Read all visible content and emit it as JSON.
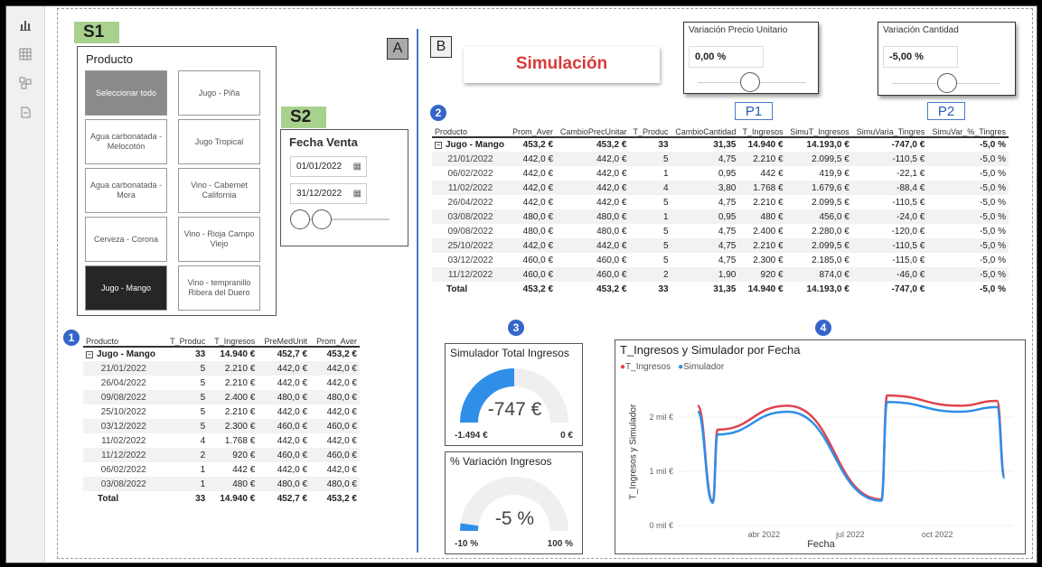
{
  "rail_icons": [
    "bar-chart-icon",
    "table-icon",
    "model-icon",
    "dax-query-icon"
  ],
  "tags": {
    "s1": "S1",
    "s2": "S2",
    "a": "A",
    "b": "B",
    "p1": "P1",
    "p2": "P2"
  },
  "markers": {
    "one": "1",
    "two": "2",
    "three": "3",
    "four": "4"
  },
  "producto_slicer": {
    "title": "Producto",
    "items": [
      "Seleccionar todo",
      "Jugo - Piña",
      "Agua carbonatada - Melocotón",
      "Jugo Tropical",
      "Agua carbonatada - Mora",
      "Vino - Cabernet California",
      "Cerveza - Corona",
      "Vino - Rioja Campo Viejo",
      "Jugo - Mango",
      "Vino - tempranillo Ribera del Duero"
    ]
  },
  "fecha_slicer": {
    "title": "Fecha Venta",
    "from": "01/01/2022",
    "to": "31/12/2022"
  },
  "simulacion_button": "Simulación",
  "param_precio": {
    "title": "Variación Precio Unitario",
    "value": "0,00 %"
  },
  "param_cantidad": {
    "title": "Variación Cantidad",
    "value": "-5,00 %"
  },
  "table1": {
    "headers": [
      "Producto",
      "T_Produc",
      "T_Ingresos",
      "PreMedUnit",
      "Prom_Aver"
    ],
    "group": [
      "Jugo - Mango",
      "33",
      "14.940 €",
      "452,7 €",
      "453,2 €"
    ],
    "rows": [
      [
        "21/01/2022",
        "5",
        "2.210 €",
        "442,0 €",
        "442,0 €"
      ],
      [
        "26/04/2022",
        "5",
        "2.210 €",
        "442,0 €",
        "442,0 €"
      ],
      [
        "09/08/2022",
        "5",
        "2.400 €",
        "480,0 €",
        "480,0 €"
      ],
      [
        "25/10/2022",
        "5",
        "2.210 €",
        "442,0 €",
        "442,0 €"
      ],
      [
        "03/12/2022",
        "5",
        "2.300 €",
        "460,0 €",
        "460,0 €"
      ],
      [
        "11/02/2022",
        "4",
        "1.768 €",
        "442,0 €",
        "442,0 €"
      ],
      [
        "11/12/2022",
        "2",
        "920 €",
        "460,0 €",
        "460,0 €"
      ],
      [
        "06/02/2022",
        "1",
        "442 €",
        "442,0 €",
        "442,0 €"
      ],
      [
        "03/08/2022",
        "1",
        "480 €",
        "480,0 €",
        "480,0 €"
      ]
    ],
    "total": [
      "Total",
      "33",
      "14.940 €",
      "452,7 €",
      "453,2 €"
    ]
  },
  "table2": {
    "headers": [
      "Producto",
      "Prom_Aver",
      "CambioPrecUnitar",
      "T_Produc",
      "CambioCantidad",
      "T_Ingresos",
      "SimuT_Ingresos",
      "SimuVaria_Tingres",
      "SimuVar_%_Tingres"
    ],
    "group": [
      "Jugo - Mango",
      "453,2 €",
      "453,2 €",
      "33",
      "31,35",
      "14.940 €",
      "14.193,0 €",
      "-747,0 €",
      "-5,0 %"
    ],
    "rows": [
      [
        "21/01/2022",
        "442,0 €",
        "442,0 €",
        "5",
        "4,75",
        "2.210 €",
        "2.099,5 €",
        "-110,5 €",
        "-5,0 %"
      ],
      [
        "06/02/2022",
        "442,0 €",
        "442,0 €",
        "1",
        "0,95",
        "442 €",
        "419,9 €",
        "-22,1 €",
        "-5,0 %"
      ],
      [
        "11/02/2022",
        "442,0 €",
        "442,0 €",
        "4",
        "3,80",
        "1.768 €",
        "1.679,6 €",
        "-88,4 €",
        "-5,0 %"
      ],
      [
        "26/04/2022",
        "442,0 €",
        "442,0 €",
        "5",
        "4,75",
        "2.210 €",
        "2.099,5 €",
        "-110,5 €",
        "-5,0 %"
      ],
      [
        "03/08/2022",
        "480,0 €",
        "480,0 €",
        "1",
        "0,95",
        "480 €",
        "456,0 €",
        "-24,0 €",
        "-5,0 %"
      ],
      [
        "09/08/2022",
        "480,0 €",
        "480,0 €",
        "5",
        "4,75",
        "2.400 €",
        "2.280,0 €",
        "-120,0 €",
        "-5,0 %"
      ],
      [
        "25/10/2022",
        "442,0 €",
        "442,0 €",
        "5",
        "4,75",
        "2.210 €",
        "2.099,5 €",
        "-110,5 €",
        "-5,0 %"
      ],
      [
        "03/12/2022",
        "460,0 €",
        "460,0 €",
        "5",
        "4,75",
        "2.300 €",
        "2.185,0 €",
        "-115,0 €",
        "-5,0 %"
      ],
      [
        "11/12/2022",
        "460,0 €",
        "460,0 €",
        "2",
        "1,90",
        "920 €",
        "874,0 €",
        "-46,0 €",
        "-5,0 %"
      ]
    ],
    "total": [
      "Total",
      "453,2 €",
      "453,2 €",
      "33",
      "31,35",
      "14.940 €",
      "14.193,0 €",
      "-747,0 €",
      "-5,0 %"
    ]
  },
  "gauge_total": {
    "title": "Simulador Total Ingresos",
    "value": "-747 €",
    "min": "-1.494 €",
    "max": "0 €",
    "fill_fraction": 0.5
  },
  "gauge_pct": {
    "title": "% Variación Ingresos",
    "value": "-5 %",
    "min": "-10 %",
    "max": "100 %",
    "fill_fraction": 0.045
  },
  "chart_data": {
    "type": "line",
    "title": "T_Ingresos y Simulador por Fecha",
    "xlabel": "Fecha",
    "ylabel": "T_Ingresos y Simulador",
    "y_ticks": [
      "0 mil €",
      "1 mil €",
      "2 mil €"
    ],
    "x_ticks": [
      "abr 2022",
      "jul 2022",
      "oct 2022"
    ],
    "ylim": [
      0,
      2500
    ],
    "series": [
      {
        "name": "T_Ingresos",
        "color": "#e0434f",
        "points": [
          [
            "2022-01-21",
            2210
          ],
          [
            "2022-02-06",
            442
          ],
          [
            "2022-02-11",
            1768
          ],
          [
            "2022-04-26",
            2210
          ],
          [
            "2022-08-03",
            480
          ],
          [
            "2022-08-09",
            2400
          ],
          [
            "2022-10-25",
            2210
          ],
          [
            "2022-12-03",
            2300
          ],
          [
            "2022-12-11",
            920
          ]
        ]
      },
      {
        "name": "Simulador",
        "color": "#2f8fe8",
        "points": [
          [
            "2022-01-21",
            2099.5
          ],
          [
            "2022-02-06",
            419.9
          ],
          [
            "2022-02-11",
            1679.6
          ],
          [
            "2022-04-26",
            2099.5
          ],
          [
            "2022-08-03",
            456
          ],
          [
            "2022-08-09",
            2280
          ],
          [
            "2022-10-25",
            2099.5
          ],
          [
            "2022-12-03",
            2185
          ],
          [
            "2022-12-11",
            874
          ]
        ]
      }
    ]
  }
}
